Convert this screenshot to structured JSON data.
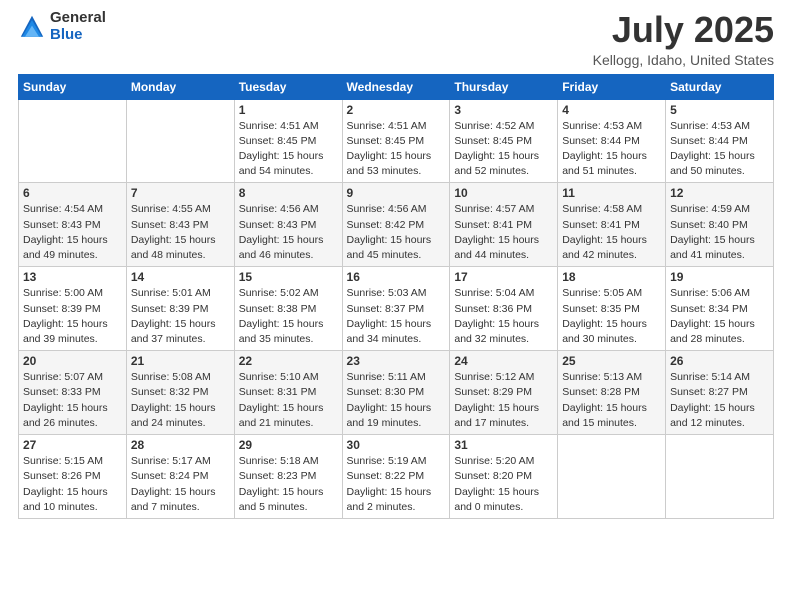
{
  "logo": {
    "general": "General",
    "blue": "Blue"
  },
  "title": "July 2025",
  "location": "Kellogg, Idaho, United States",
  "days_of_week": [
    "Sunday",
    "Monday",
    "Tuesday",
    "Wednesday",
    "Thursday",
    "Friday",
    "Saturday"
  ],
  "weeks": [
    [
      {
        "day": "",
        "info": ""
      },
      {
        "day": "",
        "info": ""
      },
      {
        "day": "1",
        "info": "Sunrise: 4:51 AM\nSunset: 8:45 PM\nDaylight: 15 hours\nand 54 minutes."
      },
      {
        "day": "2",
        "info": "Sunrise: 4:51 AM\nSunset: 8:45 PM\nDaylight: 15 hours\nand 53 minutes."
      },
      {
        "day": "3",
        "info": "Sunrise: 4:52 AM\nSunset: 8:45 PM\nDaylight: 15 hours\nand 52 minutes."
      },
      {
        "day": "4",
        "info": "Sunrise: 4:53 AM\nSunset: 8:44 PM\nDaylight: 15 hours\nand 51 minutes."
      },
      {
        "day": "5",
        "info": "Sunrise: 4:53 AM\nSunset: 8:44 PM\nDaylight: 15 hours\nand 50 minutes."
      }
    ],
    [
      {
        "day": "6",
        "info": "Sunrise: 4:54 AM\nSunset: 8:43 PM\nDaylight: 15 hours\nand 49 minutes."
      },
      {
        "day": "7",
        "info": "Sunrise: 4:55 AM\nSunset: 8:43 PM\nDaylight: 15 hours\nand 48 minutes."
      },
      {
        "day": "8",
        "info": "Sunrise: 4:56 AM\nSunset: 8:43 PM\nDaylight: 15 hours\nand 46 minutes."
      },
      {
        "day": "9",
        "info": "Sunrise: 4:56 AM\nSunset: 8:42 PM\nDaylight: 15 hours\nand 45 minutes."
      },
      {
        "day": "10",
        "info": "Sunrise: 4:57 AM\nSunset: 8:41 PM\nDaylight: 15 hours\nand 44 minutes."
      },
      {
        "day": "11",
        "info": "Sunrise: 4:58 AM\nSunset: 8:41 PM\nDaylight: 15 hours\nand 42 minutes."
      },
      {
        "day": "12",
        "info": "Sunrise: 4:59 AM\nSunset: 8:40 PM\nDaylight: 15 hours\nand 41 minutes."
      }
    ],
    [
      {
        "day": "13",
        "info": "Sunrise: 5:00 AM\nSunset: 8:39 PM\nDaylight: 15 hours\nand 39 minutes."
      },
      {
        "day": "14",
        "info": "Sunrise: 5:01 AM\nSunset: 8:39 PM\nDaylight: 15 hours\nand 37 minutes."
      },
      {
        "day": "15",
        "info": "Sunrise: 5:02 AM\nSunset: 8:38 PM\nDaylight: 15 hours\nand 35 minutes."
      },
      {
        "day": "16",
        "info": "Sunrise: 5:03 AM\nSunset: 8:37 PM\nDaylight: 15 hours\nand 34 minutes."
      },
      {
        "day": "17",
        "info": "Sunrise: 5:04 AM\nSunset: 8:36 PM\nDaylight: 15 hours\nand 32 minutes."
      },
      {
        "day": "18",
        "info": "Sunrise: 5:05 AM\nSunset: 8:35 PM\nDaylight: 15 hours\nand 30 minutes."
      },
      {
        "day": "19",
        "info": "Sunrise: 5:06 AM\nSunset: 8:34 PM\nDaylight: 15 hours\nand 28 minutes."
      }
    ],
    [
      {
        "day": "20",
        "info": "Sunrise: 5:07 AM\nSunset: 8:33 PM\nDaylight: 15 hours\nand 26 minutes."
      },
      {
        "day": "21",
        "info": "Sunrise: 5:08 AM\nSunset: 8:32 PM\nDaylight: 15 hours\nand 24 minutes."
      },
      {
        "day": "22",
        "info": "Sunrise: 5:10 AM\nSunset: 8:31 PM\nDaylight: 15 hours\nand 21 minutes."
      },
      {
        "day": "23",
        "info": "Sunrise: 5:11 AM\nSunset: 8:30 PM\nDaylight: 15 hours\nand 19 minutes."
      },
      {
        "day": "24",
        "info": "Sunrise: 5:12 AM\nSunset: 8:29 PM\nDaylight: 15 hours\nand 17 minutes."
      },
      {
        "day": "25",
        "info": "Sunrise: 5:13 AM\nSunset: 8:28 PM\nDaylight: 15 hours\nand 15 minutes."
      },
      {
        "day": "26",
        "info": "Sunrise: 5:14 AM\nSunset: 8:27 PM\nDaylight: 15 hours\nand 12 minutes."
      }
    ],
    [
      {
        "day": "27",
        "info": "Sunrise: 5:15 AM\nSunset: 8:26 PM\nDaylight: 15 hours\nand 10 minutes."
      },
      {
        "day": "28",
        "info": "Sunrise: 5:17 AM\nSunset: 8:24 PM\nDaylight: 15 hours\nand 7 minutes."
      },
      {
        "day": "29",
        "info": "Sunrise: 5:18 AM\nSunset: 8:23 PM\nDaylight: 15 hours\nand 5 minutes."
      },
      {
        "day": "30",
        "info": "Sunrise: 5:19 AM\nSunset: 8:22 PM\nDaylight: 15 hours\nand 2 minutes."
      },
      {
        "day": "31",
        "info": "Sunrise: 5:20 AM\nSunset: 8:20 PM\nDaylight: 15 hours\nand 0 minutes."
      },
      {
        "day": "",
        "info": ""
      },
      {
        "day": "",
        "info": ""
      }
    ]
  ]
}
